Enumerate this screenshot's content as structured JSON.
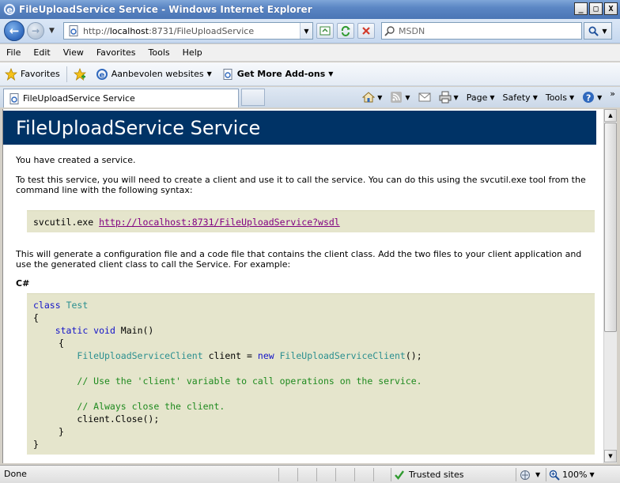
{
  "window": {
    "title": "FileUploadService Service - Windows Internet Explorer",
    "controls": [
      "_",
      "□",
      "X"
    ]
  },
  "address": {
    "url_prefix": "http://",
    "url_host": "localhost",
    "url_rest": ":8731/FileUploadService"
  },
  "search": {
    "placeholder": "MSDN"
  },
  "menu": [
    "File",
    "Edit",
    "View",
    "Favorites",
    "Tools",
    "Help"
  ],
  "favorites_bar": {
    "favorites_label": "Favorites",
    "suggested_label": "Aanbevolen websites",
    "addons_label": "Get More Add-ons"
  },
  "tab": {
    "title": "FileUploadService Service"
  },
  "commands": {
    "page": "Page",
    "safety": "Safety",
    "tools": "Tools"
  },
  "content": {
    "header": "FileUploadService Service",
    "intro": "You have created a service.",
    "instructions": "To test this service, you will need to create a client and use it to call the service. You can do this using the svcutil.exe tool from the command line with the following syntax:",
    "svcutil_cmd": "svcutil.exe ",
    "wsdl_link": "http://localhost:8731/FileUploadService?wsdl",
    "generate_text": "This will generate a configuration file and a code file that contains the client class. Add the two files to your client application and use the generated client class to call the Service. For example:",
    "cs_heading": "C#",
    "code": {
      "l1_kw": "class",
      "l1_ty": "Test",
      "l2": "{",
      "l3_kw": "static void",
      "l3_rest": " Main()",
      "l4": "{",
      "l5_ty": "FileUploadServiceClient",
      "l5_mid": " client = ",
      "l5_kw": "new",
      "l5_ty2": "FileUploadServiceClient",
      "l5_end": "();",
      "l7_cm": "// Use the 'client' variable to call operations on the service.",
      "l9_cm": "// Always close the client.",
      "l10": "client.Close();",
      "l11": "}",
      "l12": "}"
    }
  },
  "status": {
    "text": "Done",
    "zone": "Trusted sites",
    "zoom": "100%"
  }
}
